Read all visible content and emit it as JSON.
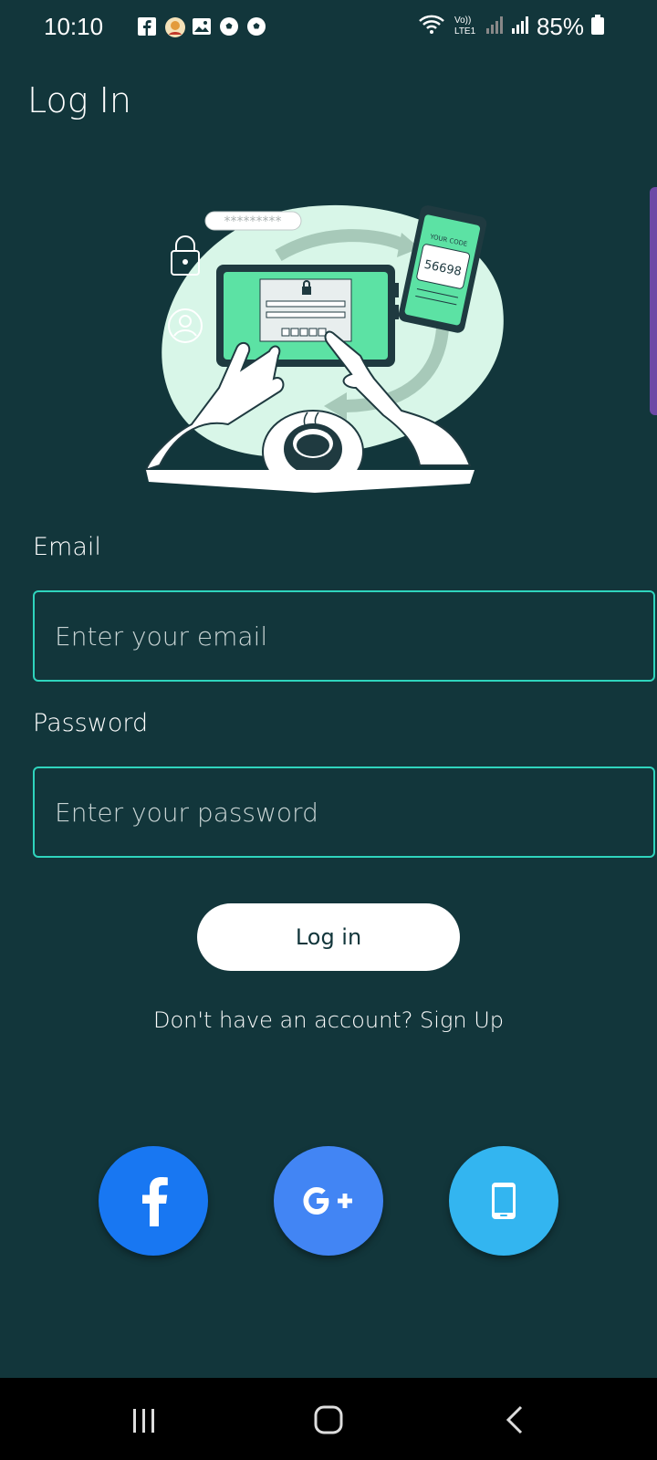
{
  "status_bar": {
    "time": "10:10",
    "battery": "85%",
    "notification_icons": [
      "facebook-icon",
      "avatar-icon",
      "gallery-icon",
      "soccer-ball-icon",
      "soccer-ball-icon"
    ],
    "indicators": [
      "wifi-icon",
      "volte-icon",
      "signal-icon",
      "signal-icon",
      "battery-icon"
    ]
  },
  "header": {
    "title": "Log In"
  },
  "illustration": {
    "password_mask": "*********",
    "phone_label": "YOUR CODE",
    "phone_code": "56698"
  },
  "form": {
    "email_label": "Email",
    "email_placeholder": "Enter your email",
    "email_value": "",
    "password_label": "Password",
    "password_placeholder": "Enter your password",
    "password_value": "",
    "login_button": "Log in",
    "signup_text": "Don't have an account? Sign Up"
  },
  "social": [
    {
      "name": "facebook",
      "icon": "facebook-icon",
      "color": "#1877f2"
    },
    {
      "name": "google-plus",
      "icon": "google-plus-icon",
      "color": "#4285f4"
    },
    {
      "name": "phone",
      "icon": "phone-icon",
      "color": "#33b5f0"
    }
  ],
  "colors": {
    "background": "#12363b",
    "accent": "#2fd4bd",
    "illustration_green": "#5ce2a4",
    "illustration_light": "#d8f6e8"
  },
  "nav_bar": [
    "recent-apps-icon",
    "home-icon",
    "back-icon"
  ]
}
